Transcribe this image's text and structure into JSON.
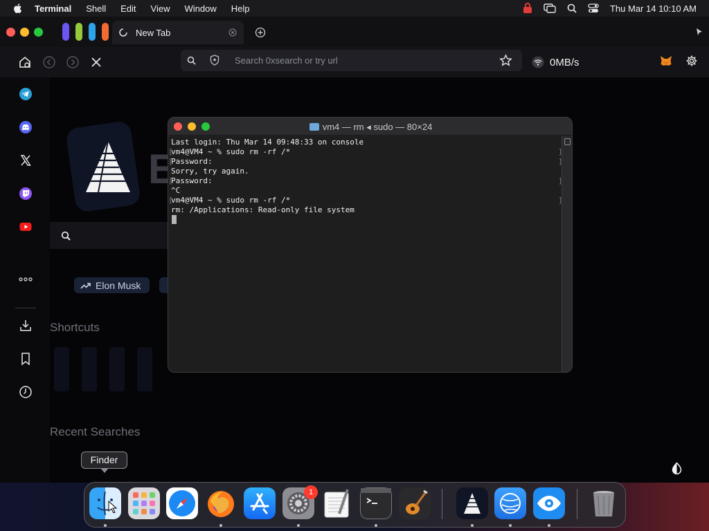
{
  "menubar": {
    "app_name": "Terminal",
    "menus": [
      "Shell",
      "Edit",
      "View",
      "Window",
      "Help"
    ],
    "clock": "Thu Mar 14  10:10 AM"
  },
  "browser": {
    "tab_title": "New Tab",
    "url_placeholder": "Search 0xsearch or try url",
    "network_speed": "0MB/s"
  },
  "page": {
    "brand_letter": "E",
    "trending_chip": "Elon Musk",
    "shortcuts_title": "Shortcuts",
    "recent_title": "Recent Searches"
  },
  "terminal": {
    "title": "vm4 — rm ◂ sudo — 80×24",
    "lines": [
      "Last login: Thu Mar 14 09:48:33 on console",
      "vm4@VM4 ~ % sudo rm -rf /*",
      "Password:",
      "Sorry, try again.",
      "Password:",
      "^C",
      "vm4@VM4 ~ % sudo rm -rf /*",
      "rm: /Applications: Read-only file system"
    ]
  },
  "dock": {
    "tooltip": "Finder",
    "settings_badge": "1"
  }
}
